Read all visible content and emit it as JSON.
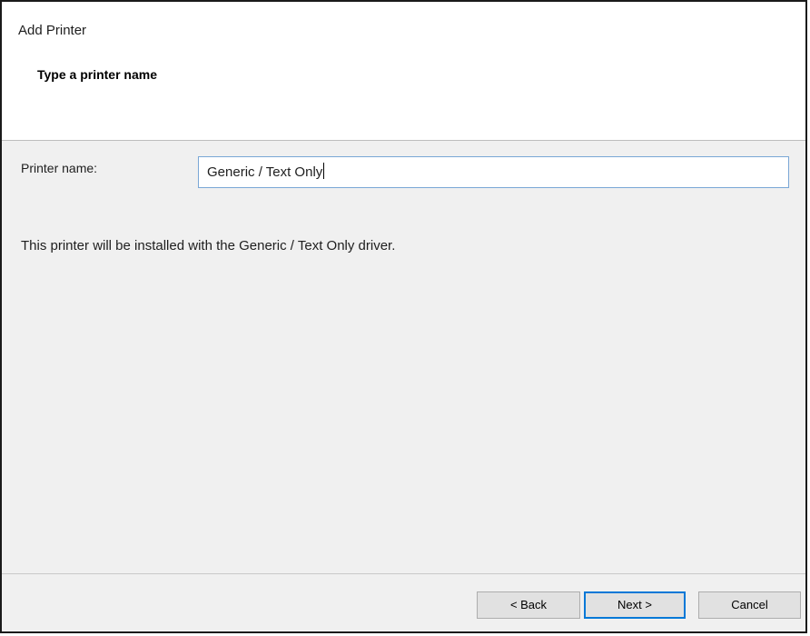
{
  "window": {
    "title": "Add Printer"
  },
  "header": {
    "step_title": "Type a printer name"
  },
  "form": {
    "printer_name_label": "Printer name:",
    "printer_name_value": "Generic / Text Only",
    "info_text": "This printer will be installed with the Generic / Text Only driver."
  },
  "buttons": {
    "back_label": "< Back",
    "next_label": "Next >",
    "cancel_label": "Cancel"
  },
  "colors": {
    "input_focus_border": "#7aa7d6",
    "default_button_accent": "#0078d7"
  }
}
